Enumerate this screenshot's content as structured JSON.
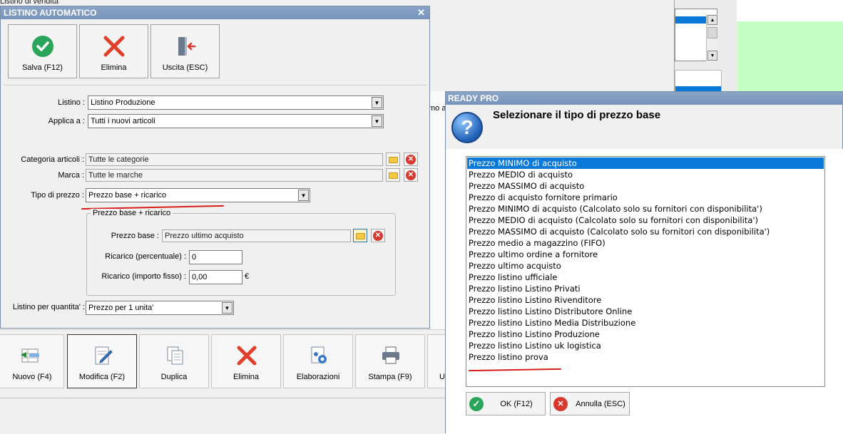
{
  "background": {
    "top_label": "Listino di vendita",
    "partial_label": "mo a"
  },
  "toolbar": {
    "buttons": [
      {
        "label": "Nuovo (F4)",
        "icon": "new-list-icon"
      },
      {
        "label": "Modifica (F2)",
        "icon": "edit-icon"
      },
      {
        "label": "Duplica",
        "icon": "duplicate-icon"
      },
      {
        "label": "Elimina",
        "icon": "delete-x-icon"
      },
      {
        "label": "Elaborazioni",
        "icon": "process-gear-icon"
      },
      {
        "label": "Stampa (F9)",
        "icon": "printer-icon"
      },
      {
        "label": "U",
        "icon": ""
      }
    ]
  },
  "dialog": {
    "title": "LISTINO AUTOMATICO",
    "close": "✕",
    "buttons": [
      {
        "label": "Salva (F12)",
        "icon": "checkmark-icon",
        "color": "#2aa55a"
      },
      {
        "label": "Elimina",
        "icon": "delete-x-icon",
        "color": "#e0402a"
      },
      {
        "label": "Uscita (ESC)",
        "icon": "exit-door-icon",
        "color": "#d9382f"
      }
    ],
    "listino_label": "Listino :",
    "listino_value": "Listino Produzione",
    "applica_label": "Applica a :",
    "applica_value": "Tutti i nuovi articoli",
    "categoria_label": "Categoria articoli :",
    "categoria_value": "Tutte le categorie",
    "marca_label": "Marca :",
    "marca_value": "Tutte le marche",
    "tipo_label": "Tipo di prezzo :",
    "tipo_value": "Prezzo base + ricarico",
    "group_title": "Prezzo base + ricarico",
    "prezzo_base_label": "Prezzo base :",
    "prezzo_base_value": "Prezzo ultimo acquisto",
    "ricarico_perc_label": "Ricarico (percentuale) :",
    "ricarico_perc_value": "0",
    "ricarico_fisso_label": "Ricarico (importo fisso) :",
    "ricarico_fisso_value": "0,00",
    "currency": "€",
    "quantita_label": "Listino per quantita' :",
    "quantita_value": "Prezzo per 1 unita'"
  },
  "ready_pro": {
    "title": "READY PRO",
    "heading": "Selezionare il tipo di prezzo base",
    "options": [
      "Prezzo MINIMO di acquisto",
      "Prezzo MEDIO di acquisto",
      "Prezzo MASSIMO di acquisto",
      "Prezzo di acquisto fornitore primario",
      "Prezzo MINIMO di acquisto (Calcolato solo su fornitori con disponibilita')",
      "Prezzo MEDIO di acquisto (Calcolato solo su fornitori con disponibilita')",
      "Prezzo MASSIMO di acquisto (Calcolato solo su fornitori con disponibilita')",
      "Prezzo medio a magazzino (FIFO)",
      "Prezzo ultimo ordine a fornitore",
      "Prezzo ultimo acquisto",
      "Prezzo listino ufficiale",
      "Prezzo listino Listino Privati",
      "Prezzo listino Listino Rivenditore",
      "Prezzo listino Listino Distributore Online",
      "Prezzo listino Listino Media Distribuzione",
      "Prezzo listino Listino Produzione",
      "Prezzo listino Listino uk logistica",
      "Prezzo listino prova"
    ],
    "selected_index": 0,
    "ok_label": "OK (F12)",
    "cancel_label": "Annulla (ESC)",
    "question_mark": "?"
  },
  "colors": {
    "selection": "#0a78d7",
    "annotation_red": "#d81b1b",
    "title_bar": "#7994bb"
  }
}
